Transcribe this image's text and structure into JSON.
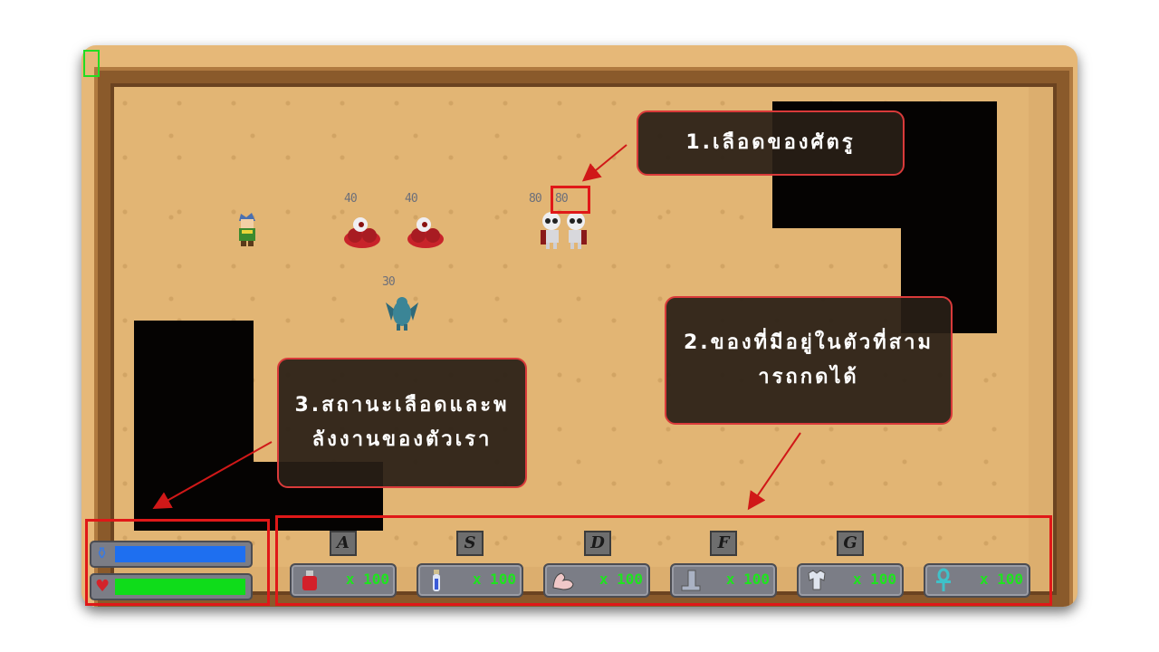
{
  "callouts": {
    "enemy_hp": "1.เลือดของศัตรู",
    "items_line1": "2.ของที่มีอยู่ในตัวที่สาม",
    "items_line2": "ารถกดได้",
    "status_line1": "3.สถานะเลือดและพ",
    "status_line2": "ลังงานของตัวเรา"
  },
  "enemies": [
    {
      "name": "red-slime",
      "hp": "40"
    },
    {
      "name": "red-slime",
      "hp": "40"
    },
    {
      "name": "skeleton",
      "hp": "80"
    },
    {
      "name": "skeleton",
      "hp": "80"
    },
    {
      "name": "gargoyle",
      "hp": "30"
    }
  ],
  "hotbar": [
    {
      "key": "A",
      "icon": "red-potion-icon",
      "count": "x 100"
    },
    {
      "key": "S",
      "icon": "blue-potion-icon",
      "count": "x 100"
    },
    {
      "key": "D",
      "icon": "strength-arm-icon",
      "count": "x 100"
    },
    {
      "key": "F",
      "icon": "boot-icon",
      "count": "x 100"
    },
    {
      "key": "G",
      "icon": "armor-icon",
      "count": "x 100"
    },
    {
      "key": "",
      "icon": "ankh-icon",
      "count": "x 100"
    }
  ],
  "status": {
    "mana_color": "#1e6ff0",
    "health_color": "#0fdc1a",
    "mana_level": 1.0,
    "health_level": 1.0
  },
  "colors": {
    "highlight": "#e01818",
    "count_text": "#1fe31f"
  }
}
